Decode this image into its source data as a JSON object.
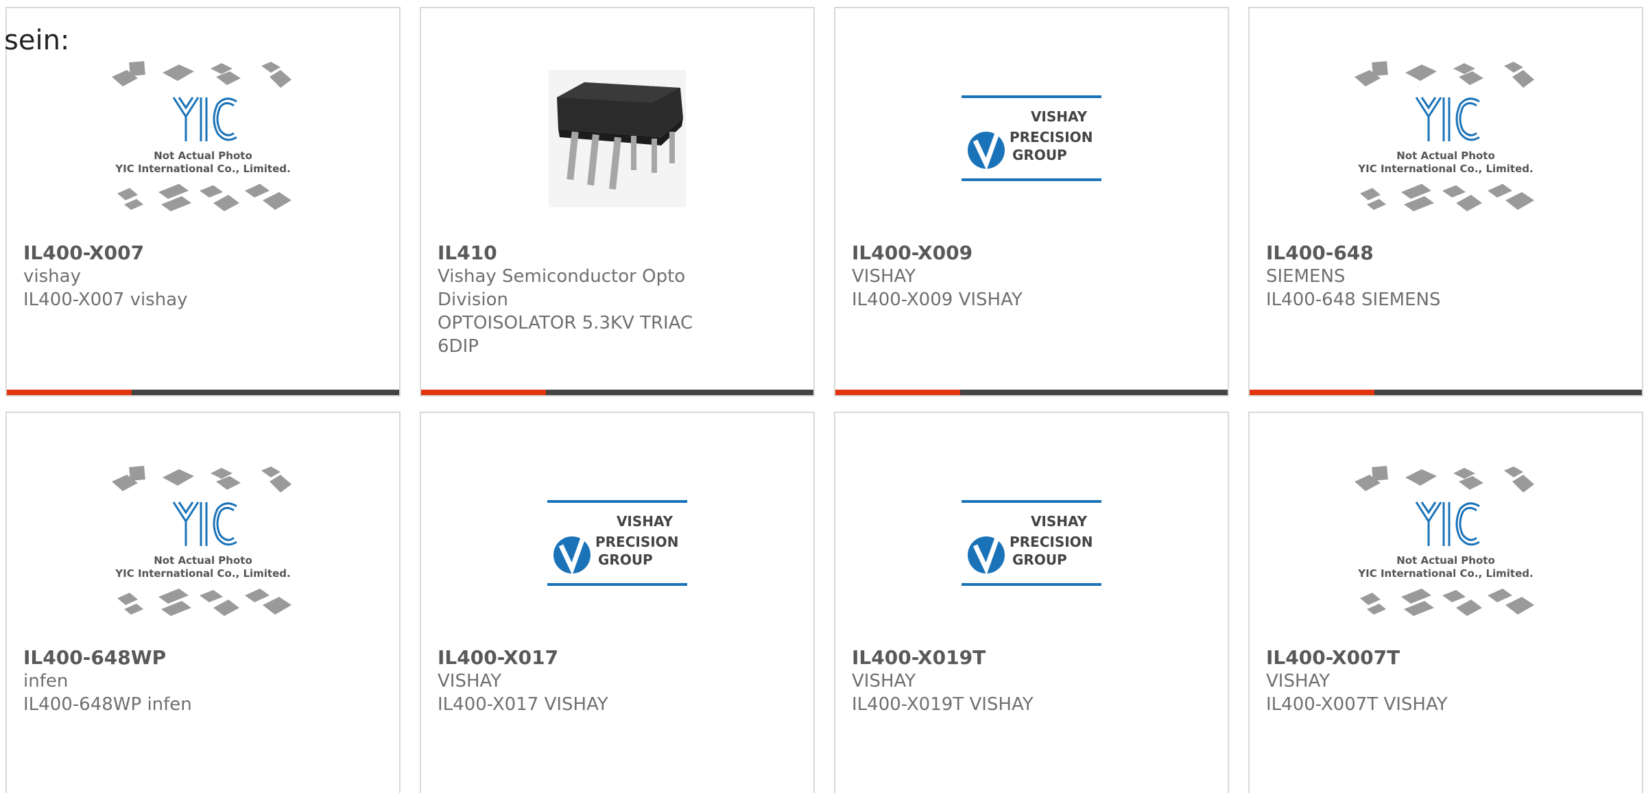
{
  "page": {
    "intro_text": "sein:"
  },
  "yic_logo": {
    "brand": "YIC",
    "line1": "Not Actual Photo",
    "line2": "YIC International Co., Limited."
  },
  "vishay_logo": {
    "line1": "VISHAY",
    "line2": "PRECISION",
    "line3": "GROUP",
    "brand_color": "#1a73b8"
  },
  "colors": {
    "accent_bar": "#e0350f",
    "bar_dark": "#444444"
  },
  "products": [
    {
      "part": "IL400-X007",
      "maker": "vishay",
      "desc": "IL400-X007 vishay",
      "image": "yic-placeholder"
    },
    {
      "part": "IL410",
      "maker": "Vishay Semiconductor Opto Division",
      "desc": "OPTOISOLATOR 5.3KV TRIAC 6DIP",
      "image": "dip-chip-photo"
    },
    {
      "part": "IL400-X009",
      "maker": "VISHAY",
      "desc": "IL400-X009 VISHAY",
      "image": "vishay-precision-logo"
    },
    {
      "part": "IL400-648",
      "maker": "SIEMENS",
      "desc": "IL400-648 SIEMENS",
      "image": "yic-placeholder"
    },
    {
      "part": "IL400-648WP",
      "maker": "infen",
      "desc": "IL400-648WP infen",
      "image": "yic-placeholder"
    },
    {
      "part": "IL400-X017",
      "maker": "VISHAY",
      "desc": "IL400-X017 VISHAY",
      "image": "vishay-precision-logo"
    },
    {
      "part": "IL400-X019T",
      "maker": "VISHAY",
      "desc": "IL400-X019T VISHAY",
      "image": "vishay-precision-logo"
    },
    {
      "part": "IL400-X007T",
      "maker": "VISHAY",
      "desc": "IL400-X007T VISHAY",
      "image": "yic-placeholder"
    }
  ]
}
